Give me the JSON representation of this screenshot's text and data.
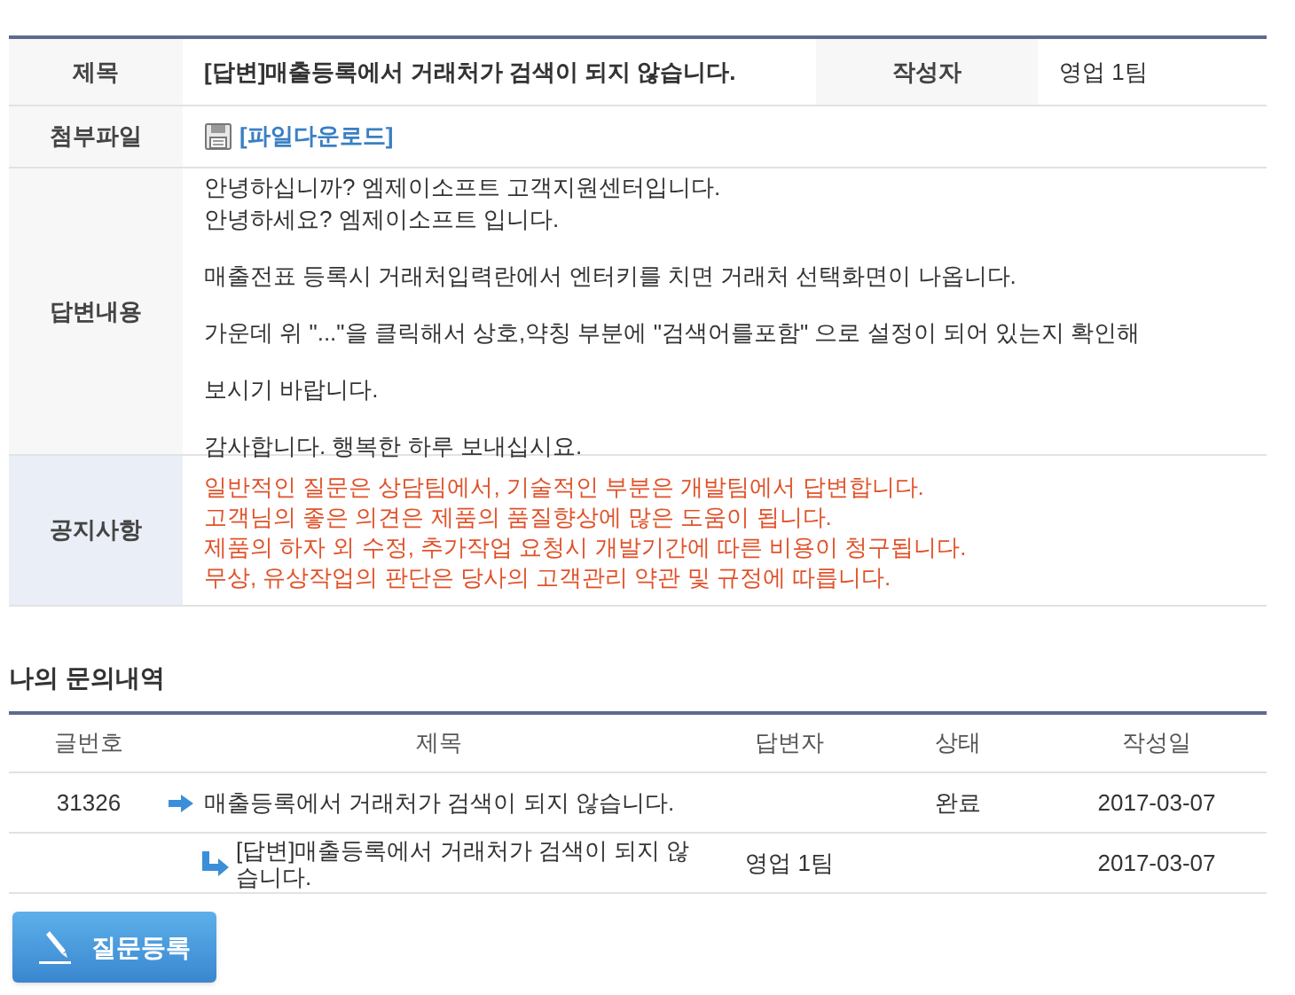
{
  "detail": {
    "title_label": "제목",
    "title": "[답변]매출등록에서 거래처가 검색이 되지 않습니다.",
    "author_label": "작성자",
    "author": "영업 1팀",
    "attachment_label": "첨부파일",
    "attachment_link": "[파일다운로드]",
    "answer_label": "답변내용",
    "answer_paragraphs": [
      [
        "안녕하십니까? 엠제이소프트 고객지원센터입니다.",
        "안녕하세요? 엠제이소프트 입니다."
      ],
      [
        "매출전표 등록시 거래처입력란에서 엔터키를 치면 거래처 선택화면이 나옵니다."
      ],
      [
        "가운데 위 \"...\"을 클릭해서 상호,약칭 부분에 \"검색어를포함\" 으로 설정이 되어 있는지 확인해"
      ],
      [
        "보시기 바랍니다."
      ],
      [
        "감사합니다. 행복한 하루 보내십시요."
      ]
    ],
    "notice_label": "공지사항",
    "notice_lines": [
      "일반적인 질문은 상담팀에서, 기술적인 부분은 개발팀에서 답변합니다.",
      "고객님의 좋은 의견은 제품의 품질향상에 많은 도움이 됩니다.",
      "제품의 하자 외 수정, 추가작업 요청시 개발기간에 따른 비용이 청구됩니다.",
      "무상, 유상작업의 판단은 당사의 고객관리 약관 및 규정에 따릅니다."
    ]
  },
  "history": {
    "heading": "나의 문의내역",
    "columns": [
      "글번호",
      "제목",
      "답변자",
      "상태",
      "작성일"
    ],
    "rows": [
      {
        "kind": "question",
        "number": "31326",
        "title": "매출등록에서 거래처가 검색이 되지 않습니다.",
        "responder": "",
        "status": "완료",
        "date": "2017-03-07"
      },
      {
        "kind": "reply",
        "number": "",
        "title": "[답변]매출등록에서 거래처가 검색이 되지 않습니다.",
        "responder": "영업 1팀",
        "status": "",
        "date": "2017-03-07"
      }
    ]
  },
  "register_button": "질문등록"
}
